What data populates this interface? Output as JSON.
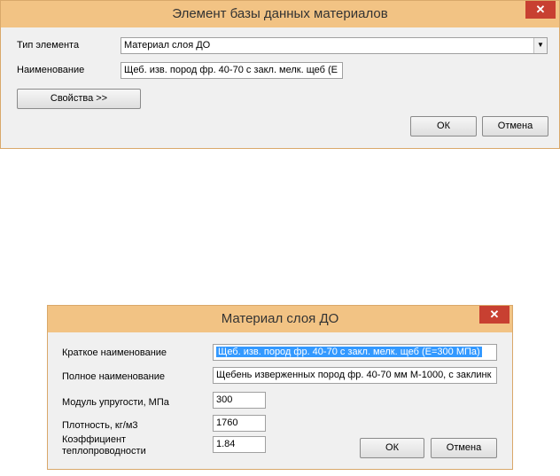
{
  "dialog1": {
    "title": "Элемент базы данных материалов",
    "close": "✕",
    "type_label": "Тип элемента",
    "type_value": "Материал слоя ДО",
    "name_label": "Наименование",
    "name_value": "Щеб. изв. пород фр. 40-70 с закл. мелк. щеб  (E",
    "properties_button": "Свойства >>",
    "ok_button": "ОК",
    "cancel_button": "Отмена"
  },
  "dialog2": {
    "title": "Материал слоя ДО",
    "close": "✕",
    "short_name_label": "Краткое наименование",
    "short_name_value": "Щеб. изв. пород фр. 40-70 с закл. мелк. щеб (E=300 МПа)",
    "full_name_label": "Полное наименование",
    "full_name_value": "Щебень изверженных пород  фр. 40-70 мм  М-1000, с заклинк",
    "modulus_label": "Модуль упругости, МПа",
    "modulus_value": "300",
    "density_label": "Плотность, кг/м3",
    "density_value": "1760",
    "conductivity_label_1": "Коэффициент",
    "conductivity_label_2": "теплопроводности",
    "conductivity_value": "1.84",
    "ok_button": "ОК",
    "cancel_button": "Отмена"
  }
}
